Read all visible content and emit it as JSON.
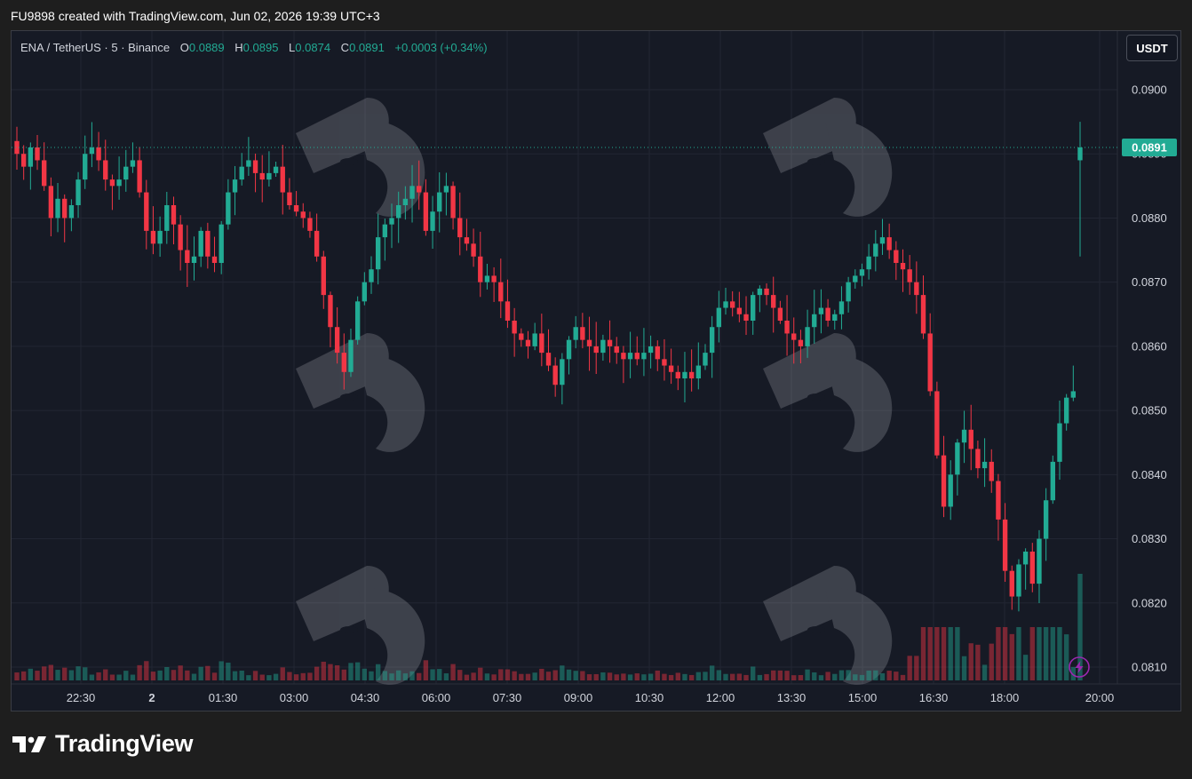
{
  "header": {
    "attribution": "FU9898 created with TradingView.com, Jun 02, 2026 19:39 UTC+3"
  },
  "legend": {
    "symbol": "ENA / TetherUS · 5 · Binance",
    "o_label": "O",
    "o_value": "0.0889",
    "h_label": "H",
    "h_value": "0.0895",
    "l_label": "L",
    "l_value": "0.0874",
    "c_label": "C",
    "c_value": "0.0891",
    "change": "+0.0003 (+0.34%)"
  },
  "currency_button": "USDT",
  "last_price_label": "0.0891",
  "footer": {
    "brand": "TradingView"
  },
  "colors": {
    "up": "#22ab94",
    "down": "#f23645",
    "background": "#161a25",
    "grid": "#222633",
    "axis_text": "#d1d4dc",
    "price_tag": "#22ab94",
    "alert": "#9c27b0"
  },
  "icons": [
    "tradingview-logo-icon",
    "watermark-icon",
    "lightning-alert-icon"
  ],
  "chart_data": {
    "type": "candlestick",
    "title": "",
    "timeframe": "5",
    "y_ticks": [
      "0.0900",
      "0.0890",
      "0.0880",
      "0.0870",
      "0.0860",
      "0.0850",
      "0.0840",
      "0.0830",
      "0.0820",
      "0.0810"
    ],
    "ylim": [
      0.08075,
      0.09025
    ],
    "x_ticks": [
      "22:30",
      "2",
      "01:30",
      "03:00",
      "04:30",
      "06:00",
      "07:30",
      "09:00",
      "10:30",
      "12:00",
      "13:30",
      "15:00",
      "16:30",
      "18:00",
      "20:00"
    ],
    "last_price": 0.0891,
    "grid": true,
    "close_series": [
      0.089,
      0.0888,
      0.0891,
      0.0889,
      0.0885,
      0.088,
      0.0883,
      0.088,
      0.0882,
      0.0886,
      0.089,
      0.0891,
      0.0889,
      0.0886,
      0.0885,
      0.0886,
      0.0888,
      0.0889,
      0.0884,
      0.0878,
      0.0876,
      0.0878,
      0.0882,
      0.0879,
      0.0875,
      0.0873,
      0.0874,
      0.0878,
      0.0874,
      0.0873,
      0.0879,
      0.0884,
      0.0886,
      0.0888,
      0.0889,
      0.0887,
      0.0886,
      0.0887,
      0.0888,
      0.0884,
      0.0882,
      0.0881,
      0.088,
      0.0878,
      0.0874,
      0.0868,
      0.0863,
      0.0859,
      0.0856,
      0.0861,
      0.0867,
      0.087,
      0.0872,
      0.0877,
      0.0879,
      0.088,
      0.0882,
      0.0883,
      0.0885,
      0.0884,
      0.0878,
      0.0881,
      0.0884,
      0.0885,
      0.088,
      0.0877,
      0.0876,
      0.0874,
      0.087,
      0.0871,
      0.087,
      0.0867,
      0.0864,
      0.0862,
      0.0861,
      0.086,
      0.0862,
      0.0859,
      0.0857,
      0.0854,
      0.0858,
      0.0861,
      0.0863,
      0.0861,
      0.086,
      0.0859,
      0.0861,
      0.086,
      0.0859,
      0.0858,
      0.0859,
      0.0858,
      0.0859,
      0.086,
      0.0858,
      0.0857,
      0.0856,
      0.0855,
      0.0856,
      0.0855,
      0.0857,
      0.0859,
      0.0863,
      0.0866,
      0.0867,
      0.0866,
      0.0865,
      0.0864,
      0.0868,
      0.0869,
      0.0868,
      0.0866,
      0.0864,
      0.0862,
      0.0861,
      0.086,
      0.0863,
      0.0865,
      0.0866,
      0.0864,
      0.0865,
      0.0867,
      0.087,
      0.0871,
      0.0872,
      0.0874,
      0.0876,
      0.0877,
      0.0875,
      0.0873,
      0.0872,
      0.087,
      0.0868,
      0.0862,
      0.0853,
      0.0843,
      0.0835,
      0.084,
      0.0845,
      0.0847,
      0.0844,
      0.0841,
      0.0842,
      0.0839,
      0.0833,
      0.0825,
      0.0821,
      0.0826,
      0.0828,
      0.0823,
      0.083,
      0.0836,
      0.0842,
      0.0848,
      0.0852,
      0.0853,
      0.0891
    ]
  }
}
